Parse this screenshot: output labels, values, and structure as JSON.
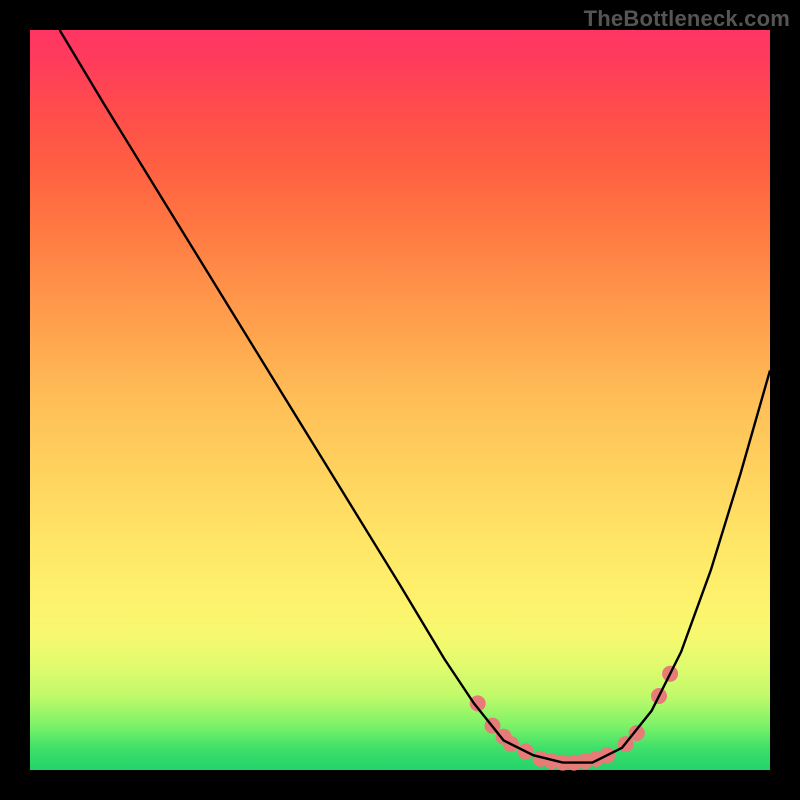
{
  "watermark": "TheBottleneck.com",
  "chart_data": {
    "type": "line",
    "title": "",
    "xlabel": "",
    "ylabel": "",
    "xlim": [
      0,
      100
    ],
    "ylim": [
      0,
      100
    ],
    "curve": {
      "x": [
        4,
        10,
        18,
        26,
        34,
        42,
        50,
        56,
        60,
        64,
        68,
        72,
        76,
        80,
        84,
        88,
        92,
        96,
        100
      ],
      "y": [
        100,
        90,
        77,
        64,
        51,
        38,
        25,
        15,
        9,
        4,
        2,
        1,
        1,
        3,
        8,
        16,
        27,
        40,
        54
      ]
    },
    "markers": {
      "x": [
        60.5,
        62.5,
        64,
        65,
        67,
        69,
        70.5,
        72,
        73.5,
        75,
        76.5,
        78,
        80.5,
        82,
        85,
        86.5
      ],
      "y": [
        9,
        6,
        4.5,
        3.5,
        2.5,
        1.5,
        1.2,
        1,
        1,
        1.2,
        1.5,
        2,
        3.5,
        5,
        10,
        13
      ],
      "radius": 8,
      "color": "#e77b78"
    }
  }
}
